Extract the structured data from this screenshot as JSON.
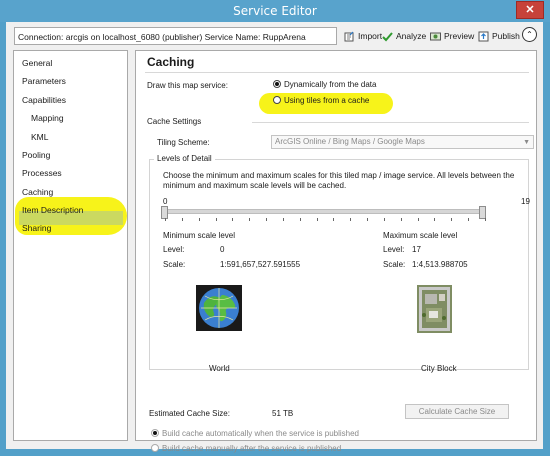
{
  "window": {
    "title": "Service Editor",
    "close_glyph": "✕"
  },
  "toolbar": {
    "connection_text": "Connection: arcgis on localhost_6080 (publisher)   Service Name: RuppArena",
    "import_label": "Import",
    "analyze_label": "Analyze",
    "preview_label": "Preview",
    "publish_label": "Publish",
    "collapse_glyph": "⌃"
  },
  "sidebar": {
    "items": [
      {
        "label": "General"
      },
      {
        "label": "Parameters"
      },
      {
        "label": "Capabilities"
      },
      {
        "label": "Mapping"
      },
      {
        "label": "KML"
      },
      {
        "label": "Pooling"
      },
      {
        "label": "Processes"
      },
      {
        "label": "Caching"
      },
      {
        "label": "Item Description"
      },
      {
        "label": "Sharing"
      }
    ],
    "selected": "Caching"
  },
  "caching": {
    "heading": "Caching",
    "draw_label": "Draw this map service:",
    "option_dynamic": "Dynamically from the data",
    "option_tiles": "Using tiles from a cache",
    "cache_settings_label": "Cache Settings",
    "tiling_scheme_label": "Tiling Scheme:",
    "tiling_scheme_value": "ArcGIS Online / Bing Maps / Google Maps",
    "lod_title": "Levels of Detail",
    "lod_desc": "Choose the minimum and maximum scales for this tiled map / image service. All levels between the minimum and maximum scale levels will be cached.",
    "slider_min": "0",
    "slider_max": "19",
    "min_scale": {
      "title": "Minimum scale level",
      "level_label": "Level:",
      "level_value": "0",
      "scale_label": "Scale:",
      "scale_value": "1:591,657,527.591555",
      "image_caption": "World"
    },
    "max_scale": {
      "title": "Maximum scale level",
      "level_label": "Level:",
      "level_value": "17",
      "scale_label": "Scale:",
      "scale_value": "1:4,513.988705",
      "image_caption": "City Block"
    },
    "estimated_label": "Estimated Cache Size:",
    "estimated_value": "51 TB",
    "calc_button": "Calculate Cache Size",
    "build_auto": "Build cache automatically when the service is published",
    "build_manual": "Build cache manually after the service is published"
  },
  "colors": {
    "highlight": "#f7f31a",
    "titlebar": "#58a3cc",
    "close": "#c7423a"
  }
}
